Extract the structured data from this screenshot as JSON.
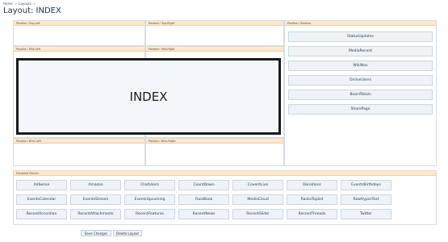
{
  "breadcrumb": {
    "home": "Home",
    "layouts": "Layouts"
  },
  "page_title": "Layout: INDEX",
  "positions": {
    "top_left": "Position: Top-Left",
    "top_right": "Position: Top-Right",
    "sidebar": "Position: Sidebar",
    "mid_left": "Position: Mid-Left",
    "mid_right": "Position: Mid-Right",
    "btm_left": "Position: Btm-Left",
    "btm_right": "Position: Btm-Right"
  },
  "index_label": "INDEX",
  "sidebar_blocks": [
    "StatusUpdates",
    "MediaRecent",
    "WikiNav",
    "OnlineUsers",
    "BoardTotals",
    "SharePage"
  ],
  "disabled": {
    "title": "Disabled Blocks",
    "rows": [
      [
        "AdSense",
        "Amazon",
        "ChatUsers",
        "CountDown",
        "CoveritLive",
        "Donations",
        "EventsBirthdays"
      ],
      [
        "EventsCalendar",
        "EventsStream",
        "EventsUpcoming",
        "FaceBook",
        "MediaCloud",
        "RanksToplist",
        "RawHyperText"
      ],
      [
        "RecentAccordion",
        "RecentAttachments",
        "RecentFeatures",
        "RecentNews",
        "RecentSlider",
        "RecentThreads",
        "Twitter"
      ]
    ]
  },
  "buttons": {
    "save": "Save Changes",
    "delete": "Delete Layout"
  },
  "colors": {
    "position_bar": "#fde8cd",
    "block_bg": "#eef3f8",
    "accent_link": "#2b5e8e"
  }
}
